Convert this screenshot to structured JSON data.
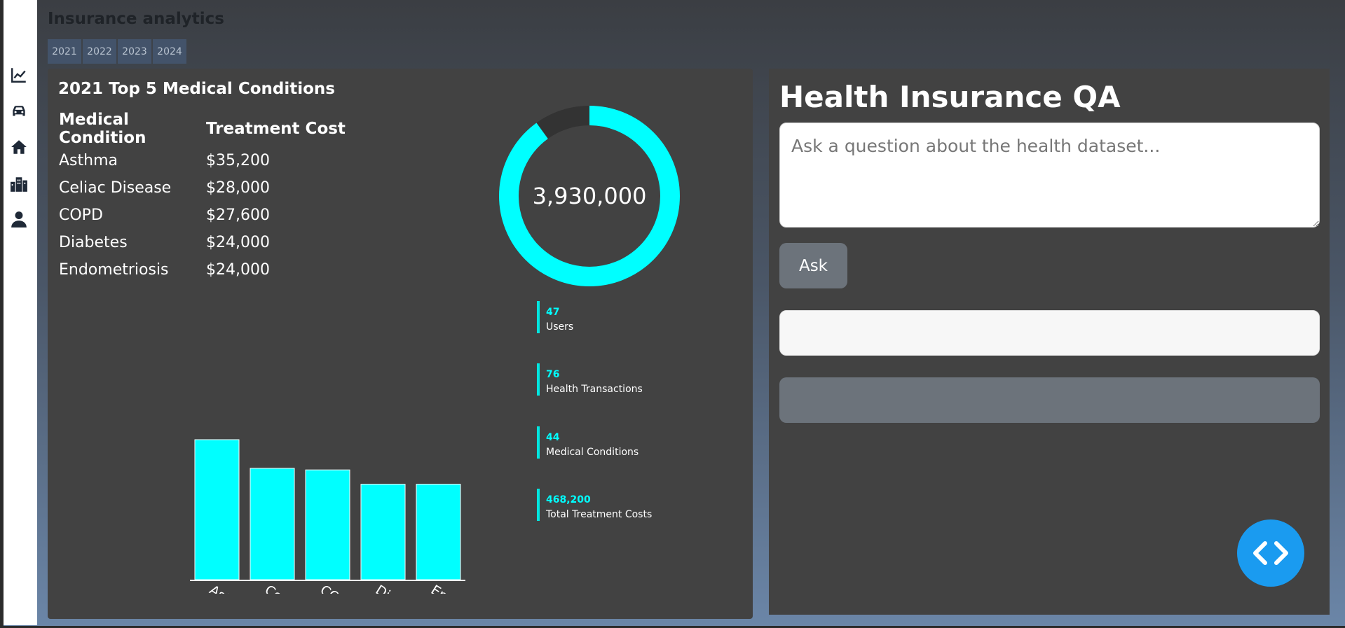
{
  "app": {
    "title": "Insurance analytics",
    "years": [
      "2021",
      "2022",
      "2023",
      "2024"
    ]
  },
  "sidebar": {
    "items": [
      {
        "icon": "chart-line-icon"
      },
      {
        "icon": "car-icon"
      },
      {
        "icon": "home-icon"
      },
      {
        "icon": "city-icon"
      },
      {
        "icon": "user-icon"
      }
    ]
  },
  "conditions_panel": {
    "title": "2021 Top 5 Medical Conditions",
    "headers": [
      "Medical Condition",
      "Treatment Cost"
    ],
    "rows": [
      {
        "condition": "Asthma",
        "cost": "$35,200"
      },
      {
        "condition": "Celiac Disease",
        "cost": "$28,000"
      },
      {
        "condition": "COPD",
        "cost": "$27,600"
      },
      {
        "condition": "Diabetes",
        "cost": "$24,000"
      },
      {
        "condition": "Endometriosis",
        "cost": "$24,000"
      }
    ],
    "donut_value": "3,930,000",
    "donut_fill_fraction": 0.9,
    "stats": [
      {
        "value": "47",
        "label": "Users"
      },
      {
        "value": "76",
        "label": "Health Transactions"
      },
      {
        "value": "44",
        "label": "Medical Conditions"
      },
      {
        "value": "468,200",
        "label": "Total Treatment Costs"
      }
    ]
  },
  "colors": {
    "accent": "#00ffff",
    "panel": "#424242",
    "fab": "#1a9bf0"
  },
  "chart_data": {
    "type": "bar",
    "categories": [
      "Asthma",
      "Celiac Disease",
      "COPD",
      "Diabetes",
      "Endometriosis"
    ],
    "values": [
      35200,
      28000,
      27600,
      24000,
      24000
    ],
    "ylim": [
      0,
      35200
    ],
    "grid": false,
    "color": "#00ffff"
  },
  "qa_panel": {
    "title": "Health Insurance QA",
    "placeholder": "Ask a question about the health dataset...",
    "ask_label": "Ask"
  }
}
